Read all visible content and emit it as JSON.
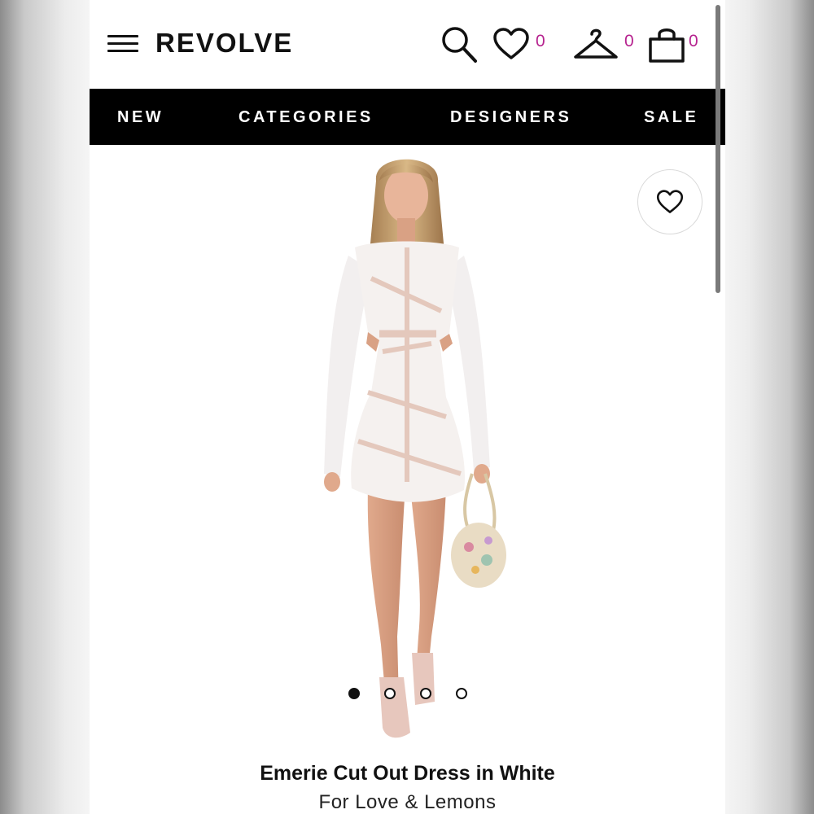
{
  "header": {
    "brand": "REVOLVE",
    "wishlist_count": "0",
    "closet_count": "0",
    "bag_count": "0"
  },
  "nav": {
    "items": [
      {
        "label": "NEW"
      },
      {
        "label": "CATEGORIES"
      },
      {
        "label": "DESIGNERS"
      },
      {
        "label": "SALE"
      }
    ]
  },
  "carousel": {
    "total": 4,
    "active_index": 0
  },
  "product": {
    "name": "Emerie Cut Out Dress in White",
    "designer": "For Love & Lemons"
  },
  "colors": {
    "accent": "#b6238f",
    "nav_bg": "#000000",
    "text": "#111111"
  },
  "icons": {
    "menu": "hamburger-icon",
    "search": "search-icon",
    "wishlist": "heart-icon",
    "closet": "hanger-icon",
    "bag": "shopping-bag-icon"
  }
}
